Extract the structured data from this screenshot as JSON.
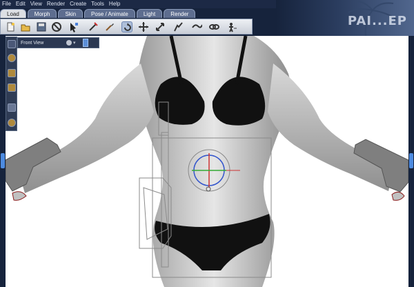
{
  "menu": [
    "File",
    "Edit",
    "View",
    "Render",
    "Create",
    "Tools",
    "Help"
  ],
  "tabs": [
    {
      "label": "Load",
      "active": true
    },
    {
      "label": "Morph",
      "active": false
    },
    {
      "label": "Skin",
      "active": false
    },
    {
      "label": "Pose / Animate",
      "active": false
    },
    {
      "label": "Light",
      "active": false
    },
    {
      "label": "Render",
      "active": false
    }
  ],
  "toolbar": {
    "buttons": [
      "new-icon",
      "open-icon",
      "save-icon",
      "stop-icon",
      "select-icon",
      "rotate-tool-icon",
      "brush-icon",
      "twist-icon",
      "move-icon",
      "scale-icon",
      "taper-icon",
      "chain-icon",
      "link-icon",
      "figure-icon"
    ],
    "selected": "twist-icon"
  },
  "viewport": {
    "title": "Front View",
    "menu_glyph": "▾",
    "scene": "3D female figure in black bikini holding pistols, with a rotation manipulator gizmo at the waist"
  },
  "camera_controls": [
    "grid-icon",
    "trackball-icon",
    "pan-icon",
    "zoom-icon",
    "frame-icon",
    "light-icon"
  ],
  "colors": {
    "menubar": "#1c2945",
    "tab_inactive": "#5d6d8f",
    "tab_active": "#dcdfe4",
    "viewport_bg": "#ffffff",
    "accent": "#4d8be0"
  }
}
